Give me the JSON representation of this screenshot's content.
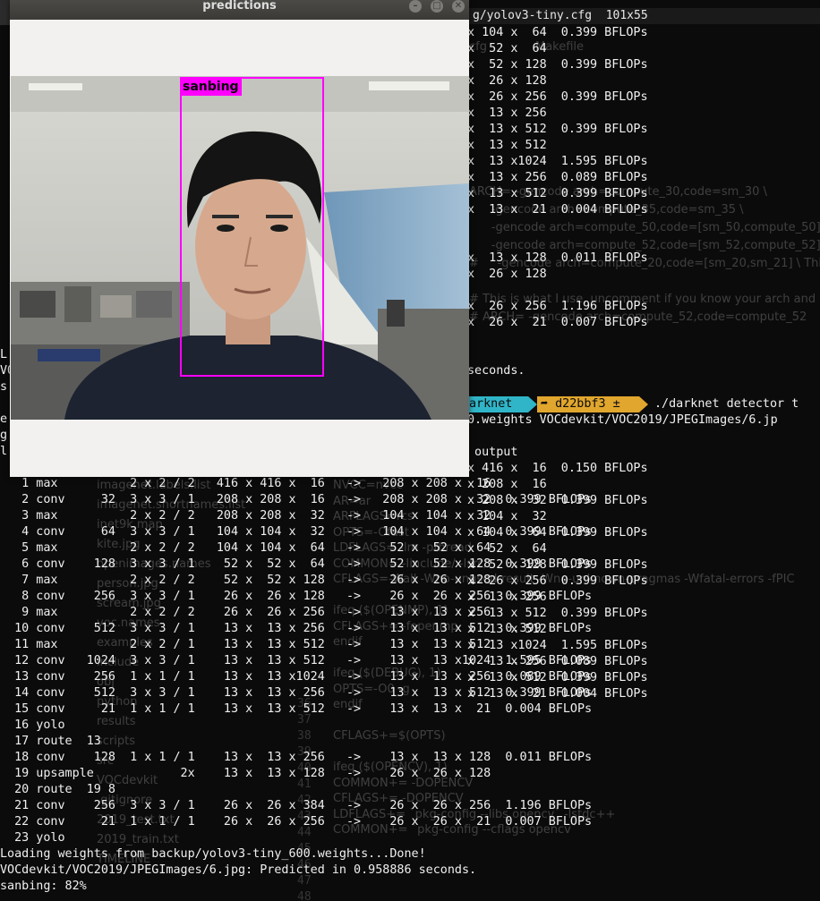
{
  "right_terminal": {
    "title": "g/yolov3-tiny.cfg  101x55",
    "lines": [
      "x 104 x  64  0.399 BFLOPs",
      "x  52 x  64",
      "x  52 x 128  0.399 BFLOPs",
      "x  26 x 128",
      "x  26 x 256  0.399 BFLOPs",
      "x  13 x 256",
      "x  13 x 512  0.399 BFLOPs",
      "x  13 x 512",
      "x  13 x1024  1.595 BFLOPs",
      "x  13 x 256  0.089 BFLOPs",
      "x  13 x 512  0.399 BFLOPs",
      "x  13 x  21  0.004 BFLOPs",
      "",
      "",
      "x  13 x 128  0.011 BFLOPs",
      "x  26 x 128",
      "",
      "x  26 x 256  1.196 BFLOPs",
      "x  26 x  21  0.007 BFLOPs",
      "",
      "",
      "seconds."
    ],
    "prompt_dir": "arknet",
    "prompt_git": "➦ d22bbf3 ±",
    "prompt_cmd": "./darknet detector t",
    "cmd_cont": "0.weights VOCdevkit/VOC2019/JPEGImages/6.jp",
    "lines2": [
      "",
      " output",
      "x 416 x  16  0.150 BFLOPs",
      "x 208 x  16",
      "x 208 x  32  0.399 BFLOPs",
      "x 104 x  32",
      "x 104 x  64  0.399 BFLOPs",
      "x  52 x  64",
      "x  52 x 128  0.399 BFLOPs",
      "x  26 x 256  0.399 BFLOPs",
      "x  13 x 256",
      "x  13 x 512  0.399 BFLOPs",
      "x  13 x 512",
      "x  13 x1024  1.595 BFLOPs",
      "x  13 x 256  0.089 BFLOPs",
      "x  13 x 512  0.399 BFLOPs",
      "x  13 x  21  0.004 BFLOPs"
    ]
  },
  "layers": [
    "   1 max          2 x 2 / 2   416 x 416 x  16   ->   208 x 208 x  16",
    "   2 conv     32  3 x 3 / 1   208 x 208 x  16   ->   208 x 208 x  32  0.399 BFLOPs",
    "   3 max          2 x 2 / 2   208 x 208 x  32   ->   104 x 104 x  32",
    "   4 conv     64  3 x 3 / 1   104 x 104 x  32   ->   104 x 104 x  64  0.399 BFLOPs",
    "   5 max          2 x 2 / 2   104 x 104 x  64   ->    52 x  52 x  64",
    "   6 conv    128  3 x 3 / 1    52 x  52 x  64   ->    52 x  52 x 128  0.399 BFLOPs",
    "   7 max          2 x 2 / 2    52 x  52 x 128   ->    26 x  26 x 128",
    "   8 conv    256  3 x 3 / 1    26 x  26 x 128   ->    26 x  26 x 256  0.399 BFLOPs",
    "   9 max          2 x 2 / 2    26 x  26 x 256   ->    13 x  13 x 256",
    "  10 conv    512  3 x 3 / 1    13 x  13 x 256   ->    13 x  13 x 512  0.399 BFLOPs",
    "  11 max          2 x 2 / 1    13 x  13 x 512   ->    13 x  13 x 512",
    "  12 conv   1024  3 x 3 / 1    13 x  13 x 512   ->    13 x  13 x1024  1.595 BFLOPs",
    "  13 conv    256  1 x 1 / 1    13 x  13 x1024   ->    13 x  13 x 256  0.089 BFLOPs",
    "  14 conv    512  3 x 3 / 1    13 x  13 x 256   ->    13 x  13 x 512  0.399 BFLOPs",
    "  15 conv     21  1 x 1 / 1    13 x  13 x 512   ->    13 x  13 x  21  0.004 BFLOPs",
    "  16 yolo",
    "  17 route  13",
    "  18 conv    128  1 x 1 / 1    13 x  13 x 256   ->    13 x  13 x 128  0.011 BFLOPs",
    "  19 upsample            2x    13 x  13 x 128   ->    26 x  26 x 128",
    "  20 route  19 8",
    "  21 conv    256  3 x 3 / 1    26 x  26 x 384   ->    26 x  26 x 256  1.196 BFLOPs",
    "  22 conv     21  1 x 1 / 1    26 x  26 x 256   ->    26 x  26 x  21  0.007 BFLOPs",
    "  23 yolo"
  ],
  "output": {
    "loading": "Loading weights from backup/yolov3-tiny_600.weights...Done!",
    "predicted": "VOCdevkit/VOC2019/JPEGImages/6.jpg: Predicted in 0.958886 seconds.",
    "result": "sanbing: 82%"
  },
  "left_fragments": [
    "L",
    "VO",
    "s",
    "e",
    "g",
    "l"
  ],
  "editor_ghost": {
    "tab_cfg": "cfg",
    "tab_makefile": "Makefile",
    "files": [
      "imagenet.labels.list",
      "imagenet.shortnames.list",
      "inet9k.map",
      "kite.jpg",
      "openimages.names",
      "person.jpg",
      "scream.jpg",
      "voc.names",
      "examples",
      "include",
      "obj",
      "python",
      "results",
      "scripts",
      "src",
      "VOCdevkit",
      ".gitignore",
      "2019_test.txt",
      "2019_train.txt",
      "TIMELINE"
    ],
    "code_left": [
      "NVCC=nvcc",
      "AR=ar",
      "ARFLAGS=rcs",
      "OPTS=-Ofast",
      "LDFLAGS= -lm -pthread",
      "COMMON= -Iinclude/ -Isrc/",
      "CFLAGS=-Wall -Wno-unused-result -Wno-unknown-pragmas -Wfatal-errors -fPIC",
      "",
      "ifeq ($(OPENMP), 1)",
      "CFLAGS+= -fopenmp",
      "endif",
      "",
      "ifeq ($(DEBUG), 1)",
      "OPTS=-O0 -g",
      "endif",
      "",
      "CFLAGS+=$(OPTS)",
      "",
      "ifeq ($(OPENCV), 1)",
      "COMMON+= -DOPENCV",
      "CFLAGS+= -DOPENCV",
      "LDFLAGS+= `pkg-config --libs opencv` -lstdc++",
      "COMMON+= `pkg-config --cflags opencv`"
    ],
    "code_right": [
      "ARCH= -gencode arch=compute_30,code=sm_30 \\",
      "      -gencode arch=compute_35,code=sm_35 \\",
      "      -gencode arch=compute_50,code=[sm_50,compute_50] \\",
      "      -gencode arch=compute_52,code=[sm_52,compute_52]",
      "#     -gencode arch=compute_20,code=[sm_20,sm_21] \\ This one is deprecated?",
      "",
      "# This is what I use, uncomment if you know your arch and want to specify",
      "# ARCH= -gencode arch=compute_52,code=compute_52"
    ],
    "line_numbers": [
      "36",
      "37",
      "38",
      "39",
      "40",
      "41",
      "42",
      "43",
      "44",
      "45",
      "46",
      "47",
      "48"
    ]
  },
  "predictions_window": {
    "title": "predictions",
    "label": "sanbing",
    "box_color": "#ff00ff"
  }
}
